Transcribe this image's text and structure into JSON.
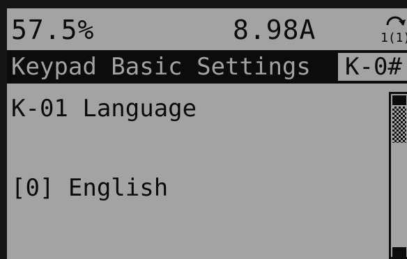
{
  "status": {
    "left_readout": "57.5%",
    "mid_readout": "8.98A",
    "mode_icon": "hand-mode-1-1-icon",
    "mode_icon_text": "1(1)"
  },
  "title_bar": {
    "title": "Keypad Basic Settings",
    "code": "K-0#"
  },
  "parameter": {
    "name": "K-01 Language",
    "value": "[0] English"
  },
  "scrollbar": {
    "position": 0.0
  },
  "colors": {
    "lcd_background": "#a3a3a3",
    "lcd_foreground": "#0a0a0a",
    "frame": "#151515"
  }
}
